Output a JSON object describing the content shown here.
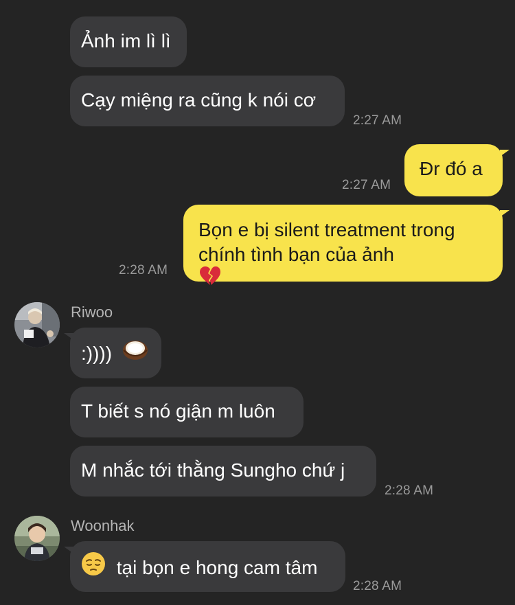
{
  "messages": [
    {
      "text": "Ảnh im lì lì"
    },
    {
      "text": "Cạy miệng ra cũng k nói cơ",
      "time": "2:27 AM"
    },
    {
      "text": "Đr đó a",
      "time": "2:27 AM"
    },
    {
      "line1": "Bọn e bị silent treatment trong",
      "line2": "chính tình bạn của ảnh",
      "emoji": "broken-heart-icon",
      "time": "2:28 AM"
    },
    {
      "sender": "Riwoo",
      "text": ":))))",
      "emoji": "coconut-icon"
    },
    {
      "text": "T biết s nó giận m luôn"
    },
    {
      "text": "M nhắc tới thằng Sungho chứ j",
      "time": "2:28 AM"
    },
    {
      "sender": "Woonhak",
      "emoji": "pensive-face-icon",
      "text": "tại bọn e hong cam tâm",
      "time": "2:28 AM"
    }
  ],
  "colors": {
    "background": "#242424",
    "incoming_bubble": "#3a3a3c",
    "outgoing_bubble": "#f8e34c",
    "timestamp": "#9a9a9a"
  }
}
